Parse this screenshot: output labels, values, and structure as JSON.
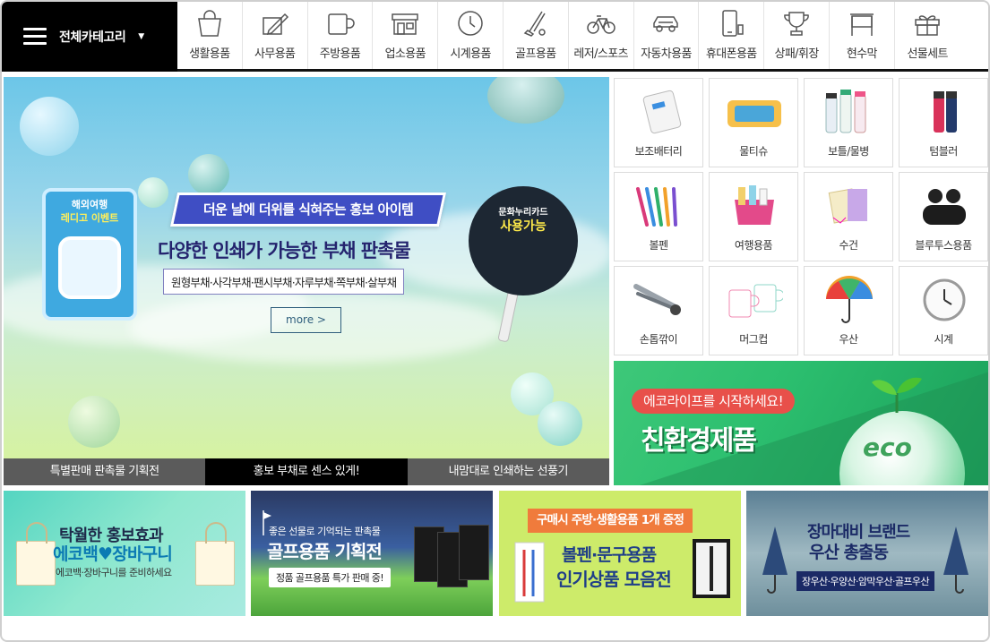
{
  "nav": {
    "all_categories": "전체카테고리",
    "categories": [
      {
        "label": "생활용품",
        "icon": "shopping-bag-icon"
      },
      {
        "label": "사무용품",
        "icon": "pencil-note-icon"
      },
      {
        "label": "주방용품",
        "icon": "mug-icon"
      },
      {
        "label": "업소용품",
        "icon": "storefront-icon"
      },
      {
        "label": "시계용품",
        "icon": "clock-icon"
      },
      {
        "label": "골프용품",
        "icon": "golf-club-icon"
      },
      {
        "label": "레저/스포츠",
        "icon": "bicycle-icon"
      },
      {
        "label": "자동차용품",
        "icon": "car-icon"
      },
      {
        "label": "휴대폰용품",
        "icon": "smartphone-icon"
      },
      {
        "label": "상패/휘장",
        "icon": "trophy-icon"
      },
      {
        "label": "현수막",
        "icon": "banner-stand-icon"
      },
      {
        "label": "선물세트",
        "icon": "gift-box-icon"
      }
    ]
  },
  "hero": {
    "ribbon": "더운 날에 더위를 식혀주는 홍보 아이템",
    "title": "다양한 인쇄가 가능한 부채 판촉물",
    "subtitle": "원형부채·사각부채·팬시부채·자루부채·쪽부채·살부채",
    "more": "more >",
    "ticket_line1": "해외여행",
    "ticket_line2": "레디고 이벤트",
    "fan_line1": "문화누리카드",
    "fan_line2": "사용가능",
    "tabs": [
      {
        "label": "특별판매 판촉물 기획전",
        "active": false
      },
      {
        "label": "홍보 부채로 센스 있게!",
        "active": true
      },
      {
        "label": "내맘대로 인쇄하는 선풍기",
        "active": false
      }
    ]
  },
  "products": [
    {
      "label": "보조배터리",
      "icon": "power-bank-icon"
    },
    {
      "label": "물티슈",
      "icon": "wet-wipes-icon"
    },
    {
      "label": "보틀/물병",
      "icon": "bottle-icon"
    },
    {
      "label": "텀블러",
      "icon": "tumbler-icon"
    },
    {
      "label": "볼펜",
      "icon": "pen-icon"
    },
    {
      "label": "여행용품",
      "icon": "travel-pouch-icon"
    },
    {
      "label": "수건",
      "icon": "towel-icon"
    },
    {
      "label": "블루투스용품",
      "icon": "earbuds-icon"
    },
    {
      "label": "손톱깎이",
      "icon": "nail-clipper-icon"
    },
    {
      "label": "머그컵",
      "icon": "mug-cup-icon"
    },
    {
      "label": "우산",
      "icon": "umbrella-icon"
    },
    {
      "label": "시계",
      "icon": "wall-clock-icon"
    }
  ],
  "eco": {
    "pill": "에코라이프를 시작하세요!",
    "title": "친환경제품",
    "globe_text": "eco"
  },
  "banners": {
    "bag": {
      "line1": "탁월한 홍보효과",
      "line2": "에코백♥장바구니",
      "line3": "에코백·장바구니를 준비하세요"
    },
    "golf": {
      "line1": "좋은 선물로 기억되는 판촉물",
      "line2": "골프용품 기획전",
      "line3": "정품 골프용품 특가 판매 중!"
    },
    "pen": {
      "tag": "구매시 주방·생활용품 1개 증정",
      "line2": "볼펜·문구용품",
      "line3": "인기상품 모음전"
    },
    "umbrella": {
      "line1": "장마대비 브랜드",
      "line2": "우산 총출동",
      "line3": "장우산·우양산·암막우산·골프우산"
    }
  },
  "colors": {
    "nav_bg": "#000000",
    "hero_active_tab": "#000000",
    "hero_tab": "#5b5b5b",
    "ribbon": "#3f4ec4",
    "eco_green": "#2cbf6f",
    "accent_red": "#e8504a"
  }
}
